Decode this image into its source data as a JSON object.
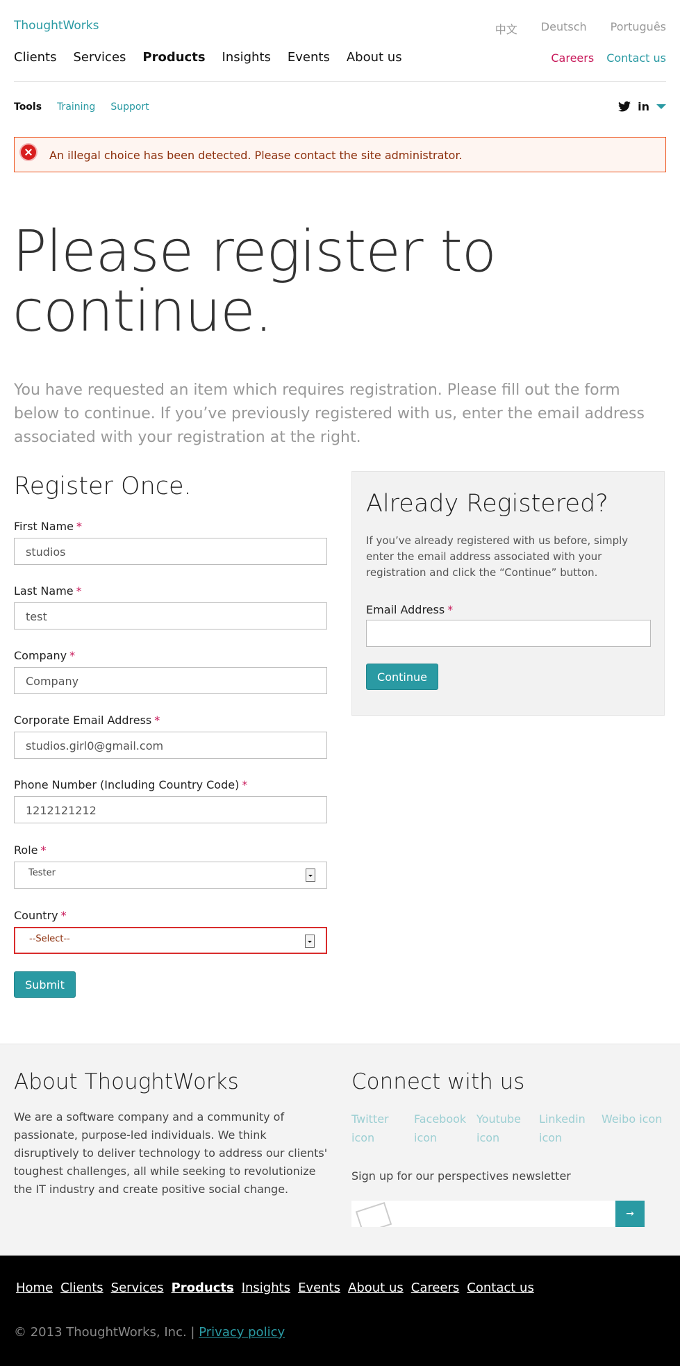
{
  "header": {
    "logo": "ThoughtWorks",
    "languages": [
      "中文",
      "Deutsch",
      "Português"
    ],
    "main_nav": [
      "Clients",
      "Services",
      "Products",
      "Insights",
      "Events",
      "About us"
    ],
    "active_nav": "Products",
    "careers": "Careers",
    "contact": "Contact us",
    "sub_nav": {
      "tools": "Tools",
      "training": "Training",
      "support": "Support"
    },
    "linkedin": "in"
  },
  "error": {
    "message": "An illegal choice has been detected. Please contact the site administrator."
  },
  "hero": {
    "title": "Please register to continue.",
    "intro": "You have requested an item which requires registration. Please fill out the form below to continue. If you’ve previously registered with us, enter the email address associated with your registration at the right."
  },
  "register": {
    "title": "Register Once.",
    "required_mark": "*",
    "fields": [
      {
        "label": "First Name",
        "value": "studios"
      },
      {
        "label": "Last Name",
        "value": "test"
      },
      {
        "label": "Company",
        "value": "Company"
      },
      {
        "label": "Corporate Email Address",
        "value": "studios.girl0@gmail.com"
      },
      {
        "label": "Phone Number (Including Country Code)",
        "value": "1212121212"
      },
      {
        "label": "Role",
        "value": "Tester"
      },
      {
        "label": "Country",
        "value": "--Select--"
      }
    ],
    "submit": "Submit"
  },
  "already": {
    "title": "Already Registered?",
    "description": "If you’ve already registered with us before, simply enter the email address associated with your registration and click the “Continue” button.",
    "email_label": "Email Address",
    "email_value": "",
    "continue": "Continue"
  },
  "footer": {
    "about_title": "About ThoughtWorks",
    "about_text": "We are a software company and a community of passionate, purpose-led individuals. We think disruptively to deliver technology to address our clients' toughest challenges, all while seeking to revolutionize the IT industry and create positive social change.",
    "connect_title": "Connect with us",
    "social_icons": [
      "Twitter icon",
      "Facebook icon",
      "Youtube icon",
      "Linkedin icon",
      "Weibo icon"
    ],
    "newsletter": "Sign up for our perspectives newsletter",
    "go": "→"
  },
  "bottom": {
    "links": [
      "Home",
      "Clients",
      "Services",
      "Products",
      "Insights",
      "Events",
      "About us",
      "Careers",
      "Contact us"
    ],
    "copyright": "© 2013 ThoughtWorks, Inc. |",
    "privacy": "Privacy policy"
  },
  "colors": {
    "accent": "#2a9aa3",
    "careers": "#c8195a",
    "error_border": "#ed541d"
  }
}
